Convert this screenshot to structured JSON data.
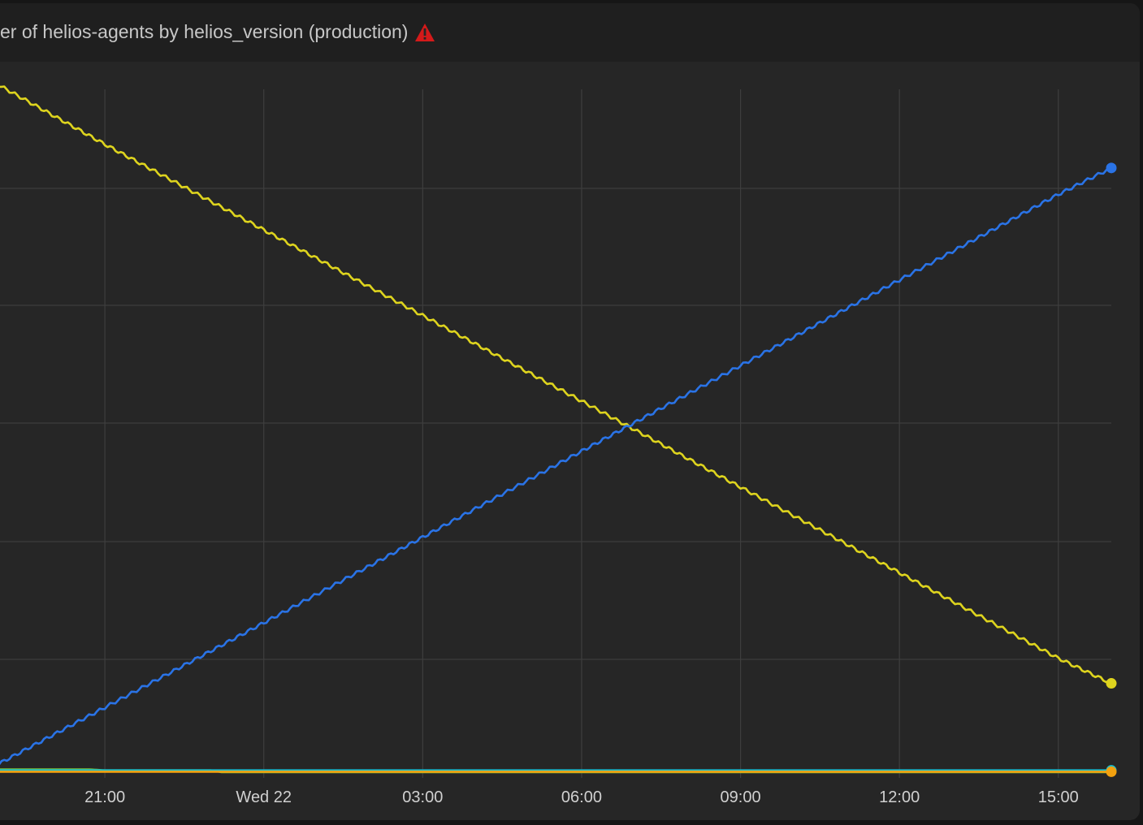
{
  "panel": {
    "title": "er of helios-agents by helios_version (production)",
    "warning_icon": "warning-triangle-icon",
    "warning_color": "#d41a1a"
  },
  "chart_data": {
    "type": "line",
    "title": "er of helios-agents by helios_version (production)",
    "xlabel": "",
    "ylabel": "",
    "x_ticks": [
      "21:00",
      "Wed 22",
      "03:00",
      "06:00",
      "09:00",
      "12:00",
      "15:00"
    ],
    "x_tick_hours": [
      21,
      24,
      27,
      30,
      33,
      36,
      39
    ],
    "xlim_hours": [
      19.02,
      40.0
    ],
    "y_gridlines": 6,
    "y_tick_labels_visible": false,
    "grid": true,
    "background": "#262626",
    "grid_color": "#3e3e3e",
    "series": [
      {
        "color": "#ded41e",
        "x_hours": [
          19.0,
          21.0,
          24.0,
          27.0,
          30.0,
          33.0,
          36.0,
          39.0,
          40.0
        ],
        "values": [
          94.0,
          81.5,
          63.4,
          45.3,
          27.2,
          9.0,
          -9.1,
          -27.2,
          -32.5
        ],
        "end_marker": true
      },
      {
        "color": "#2a73e6",
        "x_hours": [
          19.0,
          21.0,
          24.0,
          27.0,
          30.0,
          33.0,
          36.0,
          39.0,
          40.0
        ],
        "values": [
          -49.5,
          -37.6,
          -19.7,
          -1.6,
          16.6,
          34.7,
          52.8,
          70.9,
          76.5
        ],
        "end_marker": true
      },
      {
        "color": "#7dc43a",
        "x_hours": [
          19.0,
          20.7,
          21.0,
          23.0,
          23.2,
          40.0
        ],
        "values": [
          -50.7,
          -50.7,
          -50.9,
          -50.9,
          -51.3,
          -51.3
        ],
        "end_marker": false
      },
      {
        "color": "#1cbdcc",
        "x_hours": [
          19.0,
          40.0
        ],
        "values": [
          -50.9,
          -50.9
        ],
        "end_marker": true
      },
      {
        "color": "#f2a10f",
        "x_hours": [
          19.0,
          40.0
        ],
        "values": [
          -51.2,
          -51.2
        ],
        "end_marker": true
      }
    ],
    "ylim": [
      -52.5,
      100
    ]
  }
}
